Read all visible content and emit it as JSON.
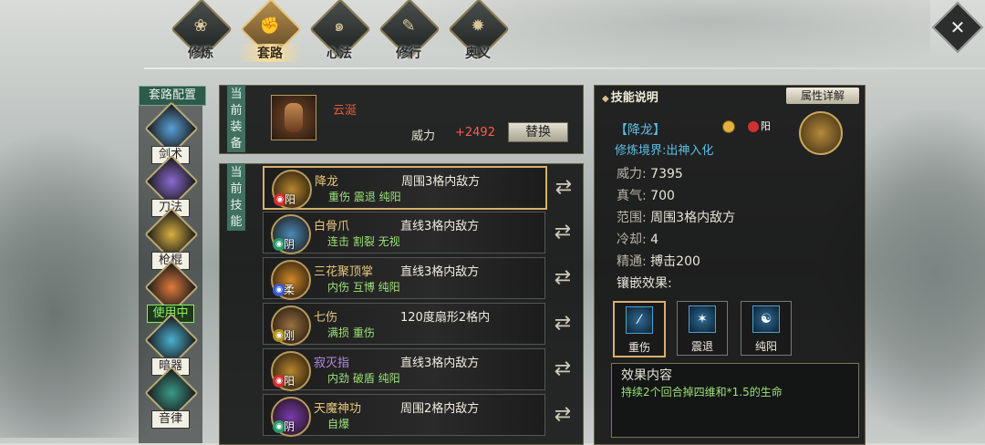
{
  "tabs": [
    {
      "label": "修炼",
      "icon": "lotus-icon",
      "active": false
    },
    {
      "label": "套路",
      "icon": "fist-icon",
      "active": true
    },
    {
      "label": "心法",
      "icon": "swirl-icon",
      "active": false
    },
    {
      "label": "修行",
      "icon": "scroll-icon",
      "active": false
    },
    {
      "label": "奥义",
      "icon": "flame-icon",
      "active": false
    }
  ],
  "sidebar": {
    "title": "套路配置",
    "items": [
      {
        "label": "剑术",
        "icon": "sword-icon",
        "color": "#5aa0d8"
      },
      {
        "label": "刀法",
        "icon": "blade-icon",
        "color": "#8a6ad0"
      },
      {
        "label": "枪棍",
        "icon": "spear-icon",
        "color": "#d8b040"
      },
      {
        "label": "使用中",
        "icon": "fist-icon",
        "color": "#e07a3a",
        "active": true
      },
      {
        "label": "暗器",
        "icon": "dart-icon",
        "color": "#4ab0d0"
      },
      {
        "label": "音律",
        "icon": "music-icon",
        "color": "#3a9a8a"
      }
    ]
  },
  "equip": {
    "label": "当前装备",
    "name": "云涎",
    "power_label": "威力",
    "power_value": "+2492",
    "replace_label": "替换"
  },
  "skills": {
    "label": "当前技能",
    "rows": [
      {
        "name": "降龙",
        "range": "周围3格内敌方",
        "tags": "重伤  震退  纯阳",
        "affinity": "阳",
        "badge_color": "#d03030",
        "icon_color": "#b8862e",
        "name_color": "#e8c67a",
        "selected": true
      },
      {
        "name": "白骨爪",
        "range": "直线3格内敌方",
        "tags": "连击  割裂  无视",
        "affinity": "阴",
        "badge_color": "#2a9a6a",
        "icon_color": "#4a8ab8",
        "name_color": "#e8c67a",
        "selected": false
      },
      {
        "name": "三花聚顶掌",
        "range": "直线3格内敌方",
        "tags": "内伤  互博  纯阳",
        "affinity": "柔",
        "badge_color": "#3a5ad0",
        "icon_color": "#d08a2a",
        "name_color": "#e8c67a",
        "selected": false
      },
      {
        "name": "七伤",
        "range": "120度扇形2格内",
        "tags": "满损  重伤",
        "affinity": "刚",
        "badge_color": "#b09020",
        "icon_color": "#9a7040",
        "name_color": "#e8c67a",
        "selected": false
      },
      {
        "name": "寂灭指",
        "range": "直线3格内敌方",
        "tags": "内劲  破盾  纯阳",
        "affinity": "阳",
        "badge_color": "#d03030",
        "icon_color": "#b8862e",
        "name_color": "#b48ae0",
        "selected": false
      },
      {
        "name": "天魔神功",
        "range": "周围2格内敌方",
        "tags": "自爆",
        "affinity": "阴",
        "badge_color": "#2a9a6a",
        "icon_color": "#7a3ab0",
        "name_color": "#e8c67a",
        "selected": false
      }
    ]
  },
  "detail": {
    "title": "技能说明",
    "attr_button": "属性详解",
    "skill_name": "【降龙】",
    "affinity": "阳",
    "level": "修炼境界:出神入化",
    "stats": [
      {
        "key": "威力:",
        "value": "7395"
      },
      {
        "key": "真气:",
        "value": "700"
      },
      {
        "key": "范围:",
        "value": "周围3格内敌方"
      },
      {
        "key": "冷却:",
        "value": "4"
      },
      {
        "key": "精通:",
        "value": "搏击200"
      }
    ],
    "inlay_title": "镶嵌效果:",
    "inlays": [
      {
        "label": "重伤",
        "icon": "slash-icon",
        "glyph": "⁄"
      },
      {
        "label": "震退",
        "icon": "burst-icon",
        "glyph": "✶"
      },
      {
        "label": "纯阳",
        "icon": "yinyang-icon",
        "glyph": "☯"
      }
    ],
    "effect_title": "效果内容",
    "effect_text": "持续2个回合掉四维和*1.5的生命"
  }
}
